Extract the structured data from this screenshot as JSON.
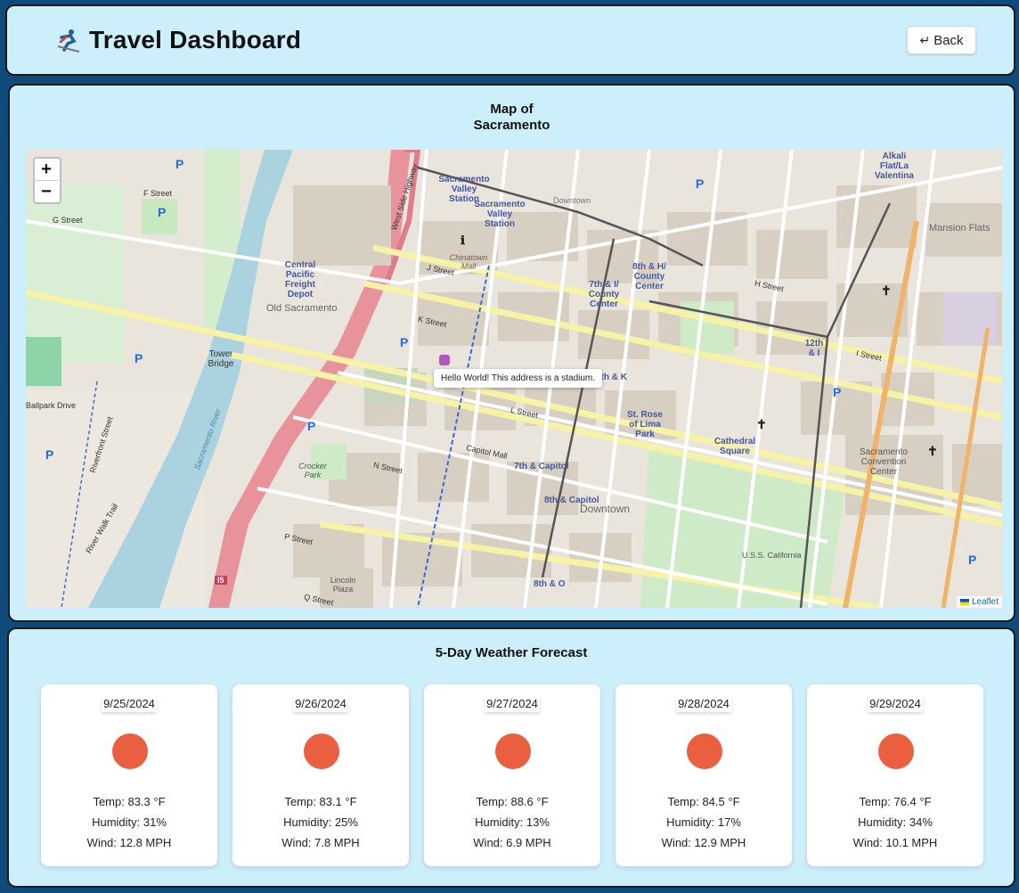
{
  "header": {
    "title": "Travel Dashboard",
    "back_label": "Back",
    "back_icon": "return-arrow-icon"
  },
  "map": {
    "title": "Map of\nSacramento",
    "zoom_in": "+",
    "zoom_out": "−",
    "popup": "Hello World! This address is a stadium.",
    "attribution": "Leaflet",
    "labels": {
      "sacramento_valley_station": "Sacramento Valley Station",
      "sacramento_valley_station_2": "Sacramento Valley Station",
      "central_pacific_depot": "Central Pacific Freight Depot",
      "old_sacramento": "Old Sacramento",
      "tower_bridge": "Tower Bridge",
      "chinatown_mall": "Chinatown Mall",
      "downtown": "Downtown",
      "downtown_top": "Downtown",
      "county_center": "7th & I/ County Center",
      "county_center_8th": "8th & H/ County Center",
      "st_rose": "St. Rose of Lima Park",
      "cathedral_square": "Cathedral Square",
      "seventh_capitol": "7th & Capitol",
      "eighth_capitol": "8th & Capitol",
      "eighth_o": "8th & O",
      "eighth_k": "8th & K",
      "twelfth_i": "12th & I",
      "crocker_park": "Crocker Park",
      "lincoln_plaza": "Lincoln Plaza",
      "convention_center": "Sacramento Convention Center",
      "mansion_flats": "Mansion Flats",
      "alkali_flat": "Alkali Flat/La Valentina",
      "uss_california": "U.S.S. California",
      "river": "Sacramento River",
      "capitol_mall": "Capitol Mall",
      "k_street": "K Street",
      "l_street": "L Street",
      "j_street": "J Street",
      "i_street": "I Street",
      "h_street": "H Street",
      "n_street": "N Street",
      "p_street": "P Street",
      "q_street": "Q Street",
      "g_street": "G Street",
      "f_street": "F Street",
      "west_side_highway": "West Side Highway",
      "riverfront_street": "Riverfront Street",
      "ballpark_drive": "Ballpark Drive",
      "river_walk_trail": "River Walk Trail",
      "highway_i5": "I5"
    }
  },
  "weather": {
    "title": "5-Day Weather Forecast",
    "days": [
      {
        "date": "9/25/2024",
        "temp": "Temp: 83.3 °F",
        "humidity": "Humidity: 31%",
        "wind": "Wind: 12.8 MPH",
        "icon": "sun-icon"
      },
      {
        "date": "9/26/2024",
        "temp": "Temp: 83.1 °F",
        "humidity": "Humidity: 25%",
        "wind": "Wind: 7.8 MPH",
        "icon": "sun-icon"
      },
      {
        "date": "9/27/2024",
        "temp": "Temp: 88.6 °F",
        "humidity": "Humidity: 13%",
        "wind": "Wind: 6.9 MPH",
        "icon": "sun-icon"
      },
      {
        "date": "9/28/2024",
        "temp": "Temp: 84.5 °F",
        "humidity": "Humidity: 17%",
        "wind": "Wind: 12.9 MPH",
        "icon": "sun-icon"
      },
      {
        "date": "9/29/2024",
        "temp": "Temp: 76.4 °F",
        "humidity": "Humidity: 34%",
        "wind": "Wind: 10.1 MPH",
        "icon": "sun-icon"
      }
    ],
    "sun_color": "#e95f40"
  },
  "colors": {
    "panel_bg": "#cdeefb",
    "page_bg": "#0f4a7a"
  }
}
